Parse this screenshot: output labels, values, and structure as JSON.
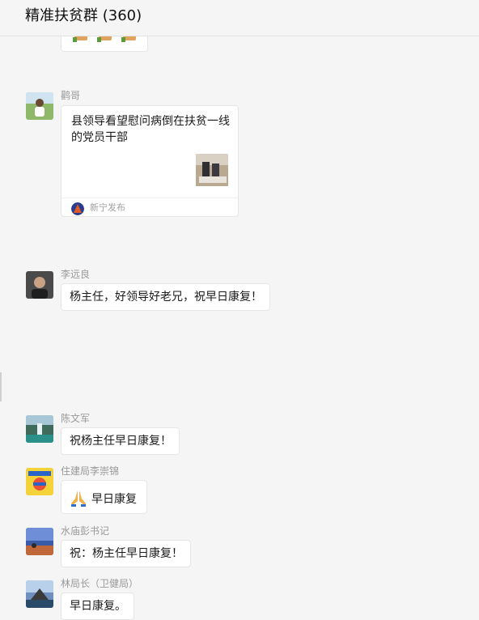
{
  "header": {
    "title": "精准扶贫群 (360)"
  },
  "messages": [
    {
      "sender": "鹳哥",
      "card": {
        "title": "县领导看望慰问病倒在扶贫一线的党员干部",
        "source": "新宁发布"
      }
    },
    {
      "sender": "李远良",
      "text": "杨主任，好领导好老兄，祝早日康复！"
    },
    {
      "sender": "陈文军",
      "text": "祝杨主任早日康复！"
    },
    {
      "sender": "住建局李崇锦",
      "emoji": "🙏",
      "text": "早日康复"
    },
    {
      "sender": "水庙彭书记",
      "text": "祝：杨主任早日康复！"
    },
    {
      "sender": "林局长（卫健局）",
      "text": "早日康复。"
    }
  ],
  "icons": {
    "emoji_hand": "thumbs-up-icon",
    "pray": "pray-hands-icon"
  },
  "colors": {
    "background": "#f5f5f5",
    "bubble": "#ffffff",
    "sender_text": "#999999"
  }
}
